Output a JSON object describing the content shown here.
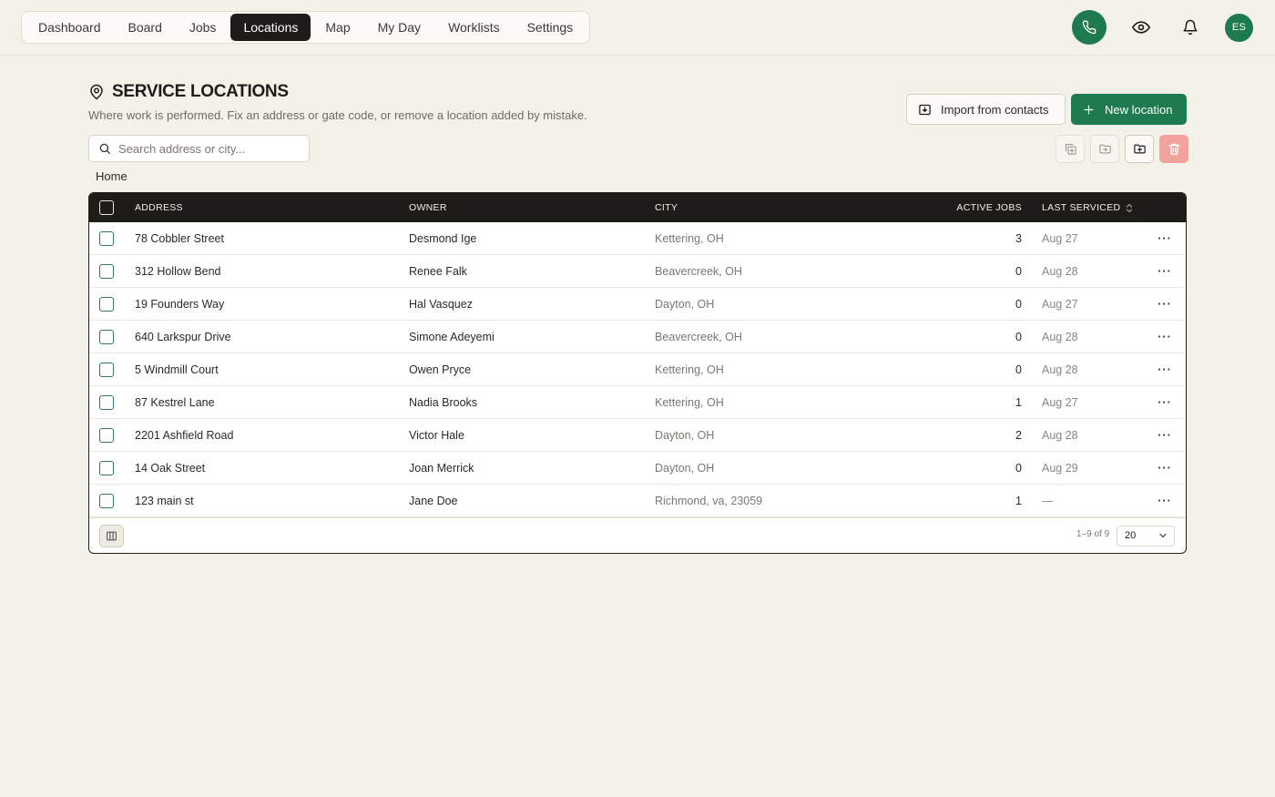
{
  "nav": {
    "items": [
      {
        "label": "Dashboard"
      },
      {
        "label": "Board"
      },
      {
        "label": "Jobs"
      },
      {
        "label": "Locations",
        "active": true
      },
      {
        "label": "Map"
      },
      {
        "label": "My Day"
      },
      {
        "label": "Worklists"
      },
      {
        "label": "Settings"
      }
    ]
  },
  "topbar": {
    "phone_icon": "phone-icon",
    "eye_icon": "eye-icon",
    "bell_icon": "bell-icon",
    "avatar_initials": "ES",
    "accent_color": "#1e7a4f"
  },
  "page": {
    "title": "SERVICE LOCATIONS",
    "subtitle": "Where work is performed. Fix an address or gate code, or remove a location added by mistake.",
    "import_label": "Import from contacts",
    "new_label": "New location",
    "search_placeholder": "Search address or city...",
    "breadcrumb": "Home"
  },
  "table": {
    "headers": {
      "address": "ADDRESS",
      "owner": "OWNER",
      "city": "CITY",
      "active_jobs": "ACTIVE JOBS",
      "last_serviced": "LAST SERVICED"
    },
    "rows": [
      {
        "address": "78 Cobbler Street",
        "owner": "Desmond Ige",
        "city": "Kettering, OH",
        "jobs": "3",
        "last": "Aug 27"
      },
      {
        "address": "312 Hollow Bend",
        "owner": "Renee Falk",
        "city": "Beavercreek, OH",
        "jobs": "0",
        "last": "Aug 28"
      },
      {
        "address": "19 Founders Way",
        "owner": "Hal Vasquez",
        "city": "Dayton, OH",
        "jobs": "0",
        "last": "Aug 27"
      },
      {
        "address": "640 Larkspur Drive",
        "owner": "Simone Adeyemi",
        "city": "Beavercreek, OH",
        "jobs": "0",
        "last": "Aug 28"
      },
      {
        "address": "5 Windmill Court",
        "owner": "Owen Pryce",
        "city": "Kettering, OH",
        "jobs": "0",
        "last": "Aug 28"
      },
      {
        "address": "87 Kestrel Lane",
        "owner": "Nadia Brooks",
        "city": "Kettering, OH",
        "jobs": "1",
        "last": "Aug 27"
      },
      {
        "address": "2201 Ashfield Road",
        "owner": "Victor Hale",
        "city": "Dayton, OH",
        "jobs": "2",
        "last": "Aug 28"
      },
      {
        "address": "14 Oak Street",
        "owner": "Joan Merrick",
        "city": "Dayton, OH",
        "jobs": "0",
        "last": "Aug 29"
      },
      {
        "address": "123 main st",
        "owner": "Jane Doe",
        "city": "Richmond, va, 23059",
        "jobs": "1",
        "last": "—"
      }
    ],
    "more_glyph": "···",
    "pagination": {
      "info": "1–9 of 9",
      "page_size": "20"
    }
  }
}
